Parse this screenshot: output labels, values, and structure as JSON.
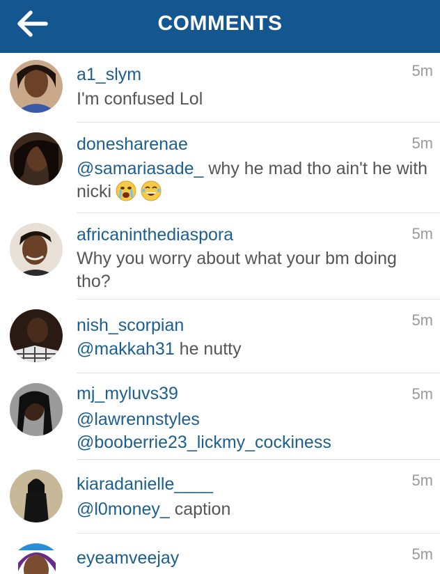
{
  "header": {
    "title": "COMMENTS",
    "back_icon": "back-arrow-icon"
  },
  "comments": [
    {
      "username": "a1_slym",
      "time": "5m",
      "text": "I'm confused Lol"
    },
    {
      "username": "donesharenae",
      "time": "5m",
      "mention": "@samariasade_",
      "text_a": " why he mad tho ain't he with nicki",
      "emojis": [
        "crying-face-emoji",
        "tears-of-joy-emoji"
      ]
    },
    {
      "username": "africaninthediaspora",
      "time": "5m",
      "text": "Why you worry about what your bm doing tho?"
    },
    {
      "username": "nish_scorpian",
      "time": "5m",
      "mention": "@makkah31",
      "text_a": " he nutty"
    },
    {
      "username": "mj_myluvs39",
      "time": "5m",
      "mention1": "@lawrennstyles",
      "mention2": "@booberrie23_lickmy_cockiness"
    },
    {
      "username": "kiaradanielle____",
      "time": "5m",
      "mention": "@l0money_",
      "text_a": " caption"
    },
    {
      "username": "eyeamveejay",
      "time": "5m"
    }
  ],
  "colors": {
    "header_bg": "#14568f",
    "username": "#1b5f91",
    "body_text": "#555555",
    "timestamp": "#9a9a9a"
  }
}
